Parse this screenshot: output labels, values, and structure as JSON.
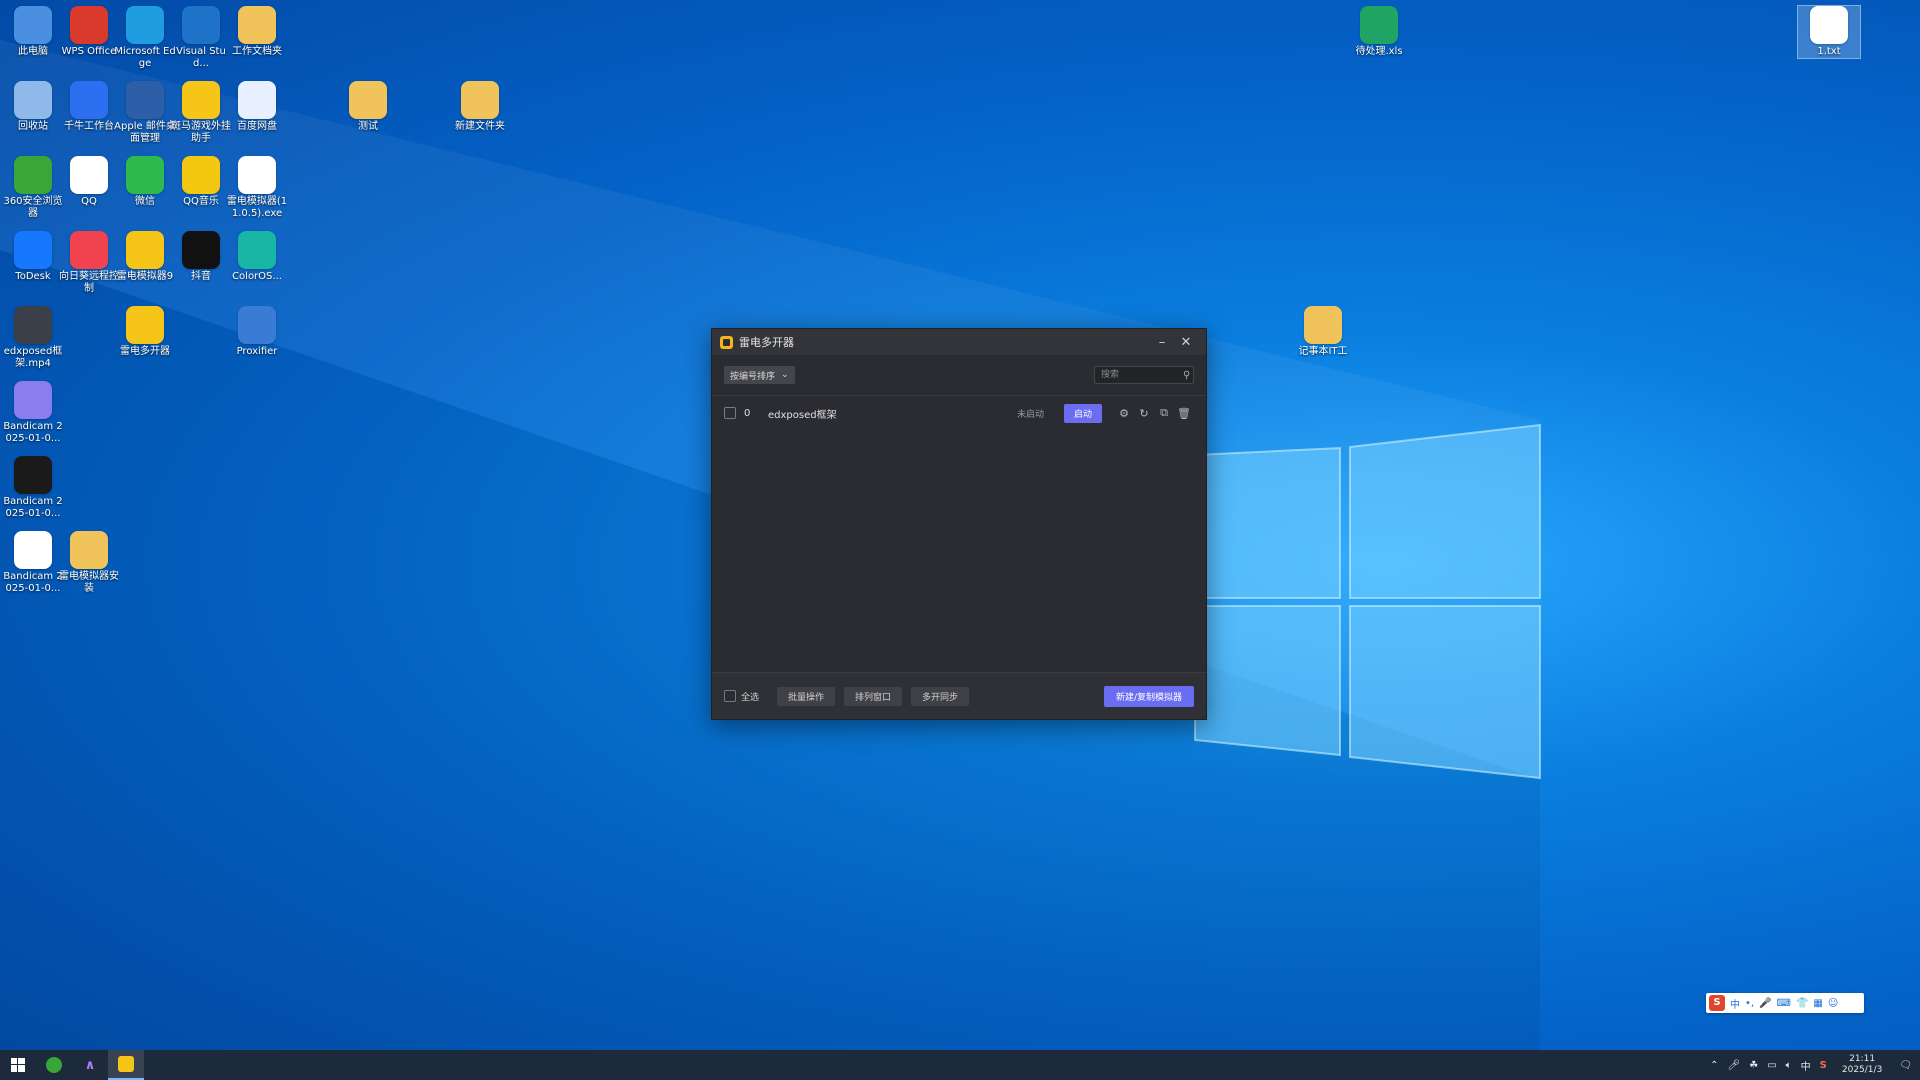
{
  "desktop": {
    "icons": [
      {
        "label": "此电脑",
        "icon": "computer-icon",
        "color": "#4a8fe0"
      },
      {
        "label": "WPS Office",
        "icon": "wps-icon",
        "color": "#d93a2b"
      },
      {
        "label": "Microsoft Edge",
        "icon": "edge-icon",
        "color": "#1e9de0"
      },
      {
        "label": "Visual Stud...",
        "icon": "vscode-icon",
        "color": "#1e73c8"
      },
      {
        "label": "工作文档夹",
        "icon": "folder-icon",
        "color": "#f1c45b"
      },
      {
        "label": "回收站",
        "icon": "recycle-bin-icon",
        "color": "#8fb9e8"
      },
      {
        "label": "千牛工作台",
        "icon": "qianniu-icon",
        "color": "#2d6ff0"
      },
      {
        "label": "Apple 邮件桌面管理",
        "icon": "mail-icon",
        "color": "#2c5fa8"
      },
      {
        "label": "斑马游戏外挂助手",
        "icon": "chick-icon",
        "color": "#f5c518"
      },
      {
        "label": "百度网盘",
        "icon": "baidu-netdisk-icon",
        "color": "#e8f0ff"
      },
      {
        "label": "测试",
        "icon": "zip-folder-icon",
        "color": "#f1c45b"
      },
      {
        "label": "新建文件夹",
        "icon": "zip-folder-icon",
        "color": "#f1c45b"
      },
      {
        "label": "360安全浏览器",
        "icon": "browser-360-icon",
        "color": "#3aa63a"
      },
      {
        "label": "QQ",
        "icon": "qq-icon",
        "color": "#ffffff"
      },
      {
        "label": "微信",
        "icon": "wechat-icon",
        "color": "#2dbb4e"
      },
      {
        "label": "QQ音乐",
        "icon": "qqmusic-icon",
        "color": "#f2c811"
      },
      {
        "label": "雷电模拟器(11.0.5).exe",
        "icon": "file-icon",
        "color": "#ffffff"
      },
      {
        "label": "ToDesk",
        "icon": "todesk-icon",
        "color": "#1677ff"
      },
      {
        "label": "向日葵远程控制",
        "icon": "sunflower-icon",
        "color": "#f0424f"
      },
      {
        "label": "雷电模拟器9",
        "icon": "ldplayer-icon",
        "color": "#f5c518"
      },
      {
        "label": "抖音",
        "icon": "douyin-icon",
        "color": "#111111"
      },
      {
        "label": "ColorOS...",
        "icon": "coloros-icon",
        "color": "#19b5a5"
      },
      {
        "label": "edxposed框架.mp4",
        "icon": "video-thumb-icon",
        "color": "#3a3f4a"
      },
      {
        "label": "雷电多开器",
        "icon": "ld-multi-icon",
        "color": "#f5c518"
      },
      {
        "label": "Proxifier",
        "icon": "proxifier-icon",
        "color": "#3a7bd5"
      },
      {
        "label": "Bandicam 2025-01-0...",
        "icon": "bandicam-video-icon",
        "color": "#8b7cf0"
      },
      {
        "label": "Bandicam 2025-01-0...",
        "icon": "bandicam-icon",
        "color": "#1a1a1a"
      },
      {
        "label": "Bandicam 2025-01-0...",
        "icon": "video-file-icon",
        "color": "#ffffff"
      },
      {
        "label": "雷电模拟器安装",
        "icon": "folder-icon",
        "color": "#f1c45b"
      },
      {
        "label": "待处理.xls",
        "icon": "wps-sheet-icon",
        "color": "#1fa463"
      },
      {
        "label": "记事本IT工",
        "icon": "zip-folder-icon",
        "color": "#f1c45b"
      },
      {
        "label": "1.txt",
        "icon": "text-file-icon",
        "color": "#ffffff"
      }
    ]
  },
  "window": {
    "title": "雷电多开器",
    "sort_label": "按编号排序",
    "search_placeholder": "搜索",
    "rows": [
      {
        "index": "0",
        "name": "edxposed框架",
        "status": "未启动",
        "action": "启动"
      }
    ],
    "footer": {
      "select_all": "全选",
      "batch": "批量操作",
      "arrange": "排列窗口",
      "multi_sync": "多开同步",
      "new_button": "新建/复制模拟器"
    },
    "accent": "#6a6df2"
  },
  "ime": {
    "logo": "S",
    "lang": "中",
    "items": [
      "•,",
      "🎤",
      "⌨",
      "👕",
      "▦",
      "☺"
    ]
  },
  "taskbar": {
    "clock_time": "21:11",
    "clock_date": "2025/1/3",
    "tray_lang": "中",
    "color": "#1c2a3b"
  }
}
